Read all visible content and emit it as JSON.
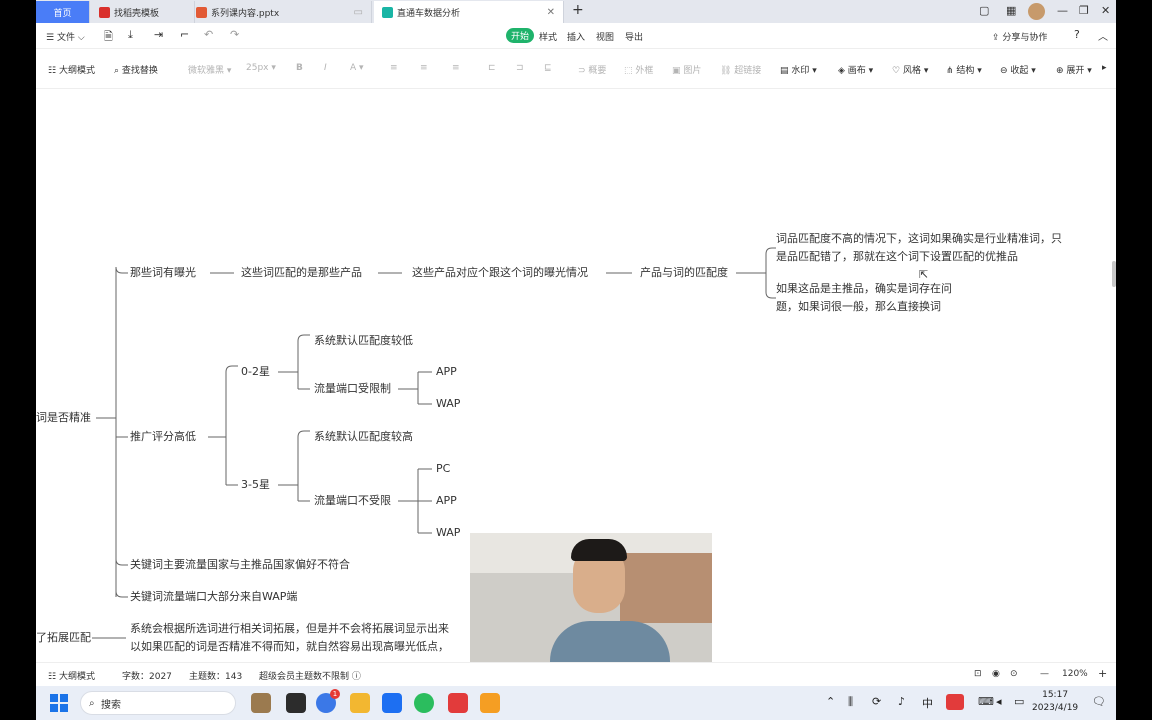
{
  "tabs": {
    "home": "首页",
    "templates": "找稻壳模板",
    "pptx": "系列课内容.pptx",
    "active": "直通车数据分析",
    "new_tab": "+"
  },
  "menu": {
    "file": "文件",
    "start": "开始",
    "style": "样式",
    "insert": "插入",
    "view": "视图",
    "export": "导出",
    "share": "分享与协作",
    "help": "?"
  },
  "toolbar": {
    "outline_mode": "大纲模式",
    "find_replace": "查找替换",
    "font": "微软雅黑",
    "font_size": "25px",
    "bold": "B",
    "italic": "I",
    "font_color": "A",
    "summary": "概要",
    "frame": "外框",
    "image": "图片",
    "hyperlink": "超链接",
    "watermark": "水印",
    "canvas": "画布",
    "theme": "风格",
    "structure": "结构",
    "collapse": "收起",
    "expand": "展开"
  },
  "mindmap": {
    "root": "词是否精准",
    "branch1": {
      "label": "那些词有曝光",
      "n2": "这些词匹配的是那些产品",
      "n3": "这些产品对应个跟这个词的曝光情况",
      "n4": "产品与词的匹配度",
      "note1_line1": "词品匹配度不高的情况下，这词如果确实是行业精准词，只",
      "note1_line2": "是品匹配错了，那就在这个词下设置匹配的优推品",
      "note2_line1": "如果这品是主推品，确实是词存在问",
      "note2_line2": "题，如果词很一般，那么直接换词"
    },
    "branch2": {
      "label": "推广评分高低",
      "star_low": "0-2星",
      "low_default": "系统默认匹配度较低",
      "low_port": "流量端口受限制",
      "low_ports": [
        "APP",
        "WAP"
      ],
      "star_high": "3-5星",
      "high_default": "系统默认匹配度较高",
      "high_port": "流量端口不受限",
      "high_ports": [
        "PC",
        "APP",
        "WAP"
      ]
    },
    "branch3": "关键词主要流量国家与主推品国家偏好不符合",
    "branch4": "关键词流量端口大部分来自WAP端",
    "sibling": "了拓展匹配",
    "sibling_line1": "系统会根据所选词进行相关词拓展，但是并不会将拓展词显示出来",
    "sibling_line2": "以如果匹配的词是否精准不得而知，就自然容易出现高曝光低点，"
  },
  "status": {
    "outline_mode": "大纲模式",
    "word_count": "字数：2027",
    "topic_count": "主题数：143",
    "vip": "超级会员主题数不限制",
    "zoom": "120%"
  },
  "taskbar": {
    "search": "搜索",
    "time": "15:17",
    "date": "2023/4/19",
    "badge": "1"
  },
  "colors": {
    "tab_home": "#4a7df7",
    "start_green": "#1fb36b",
    "line_gray": "#555555"
  }
}
